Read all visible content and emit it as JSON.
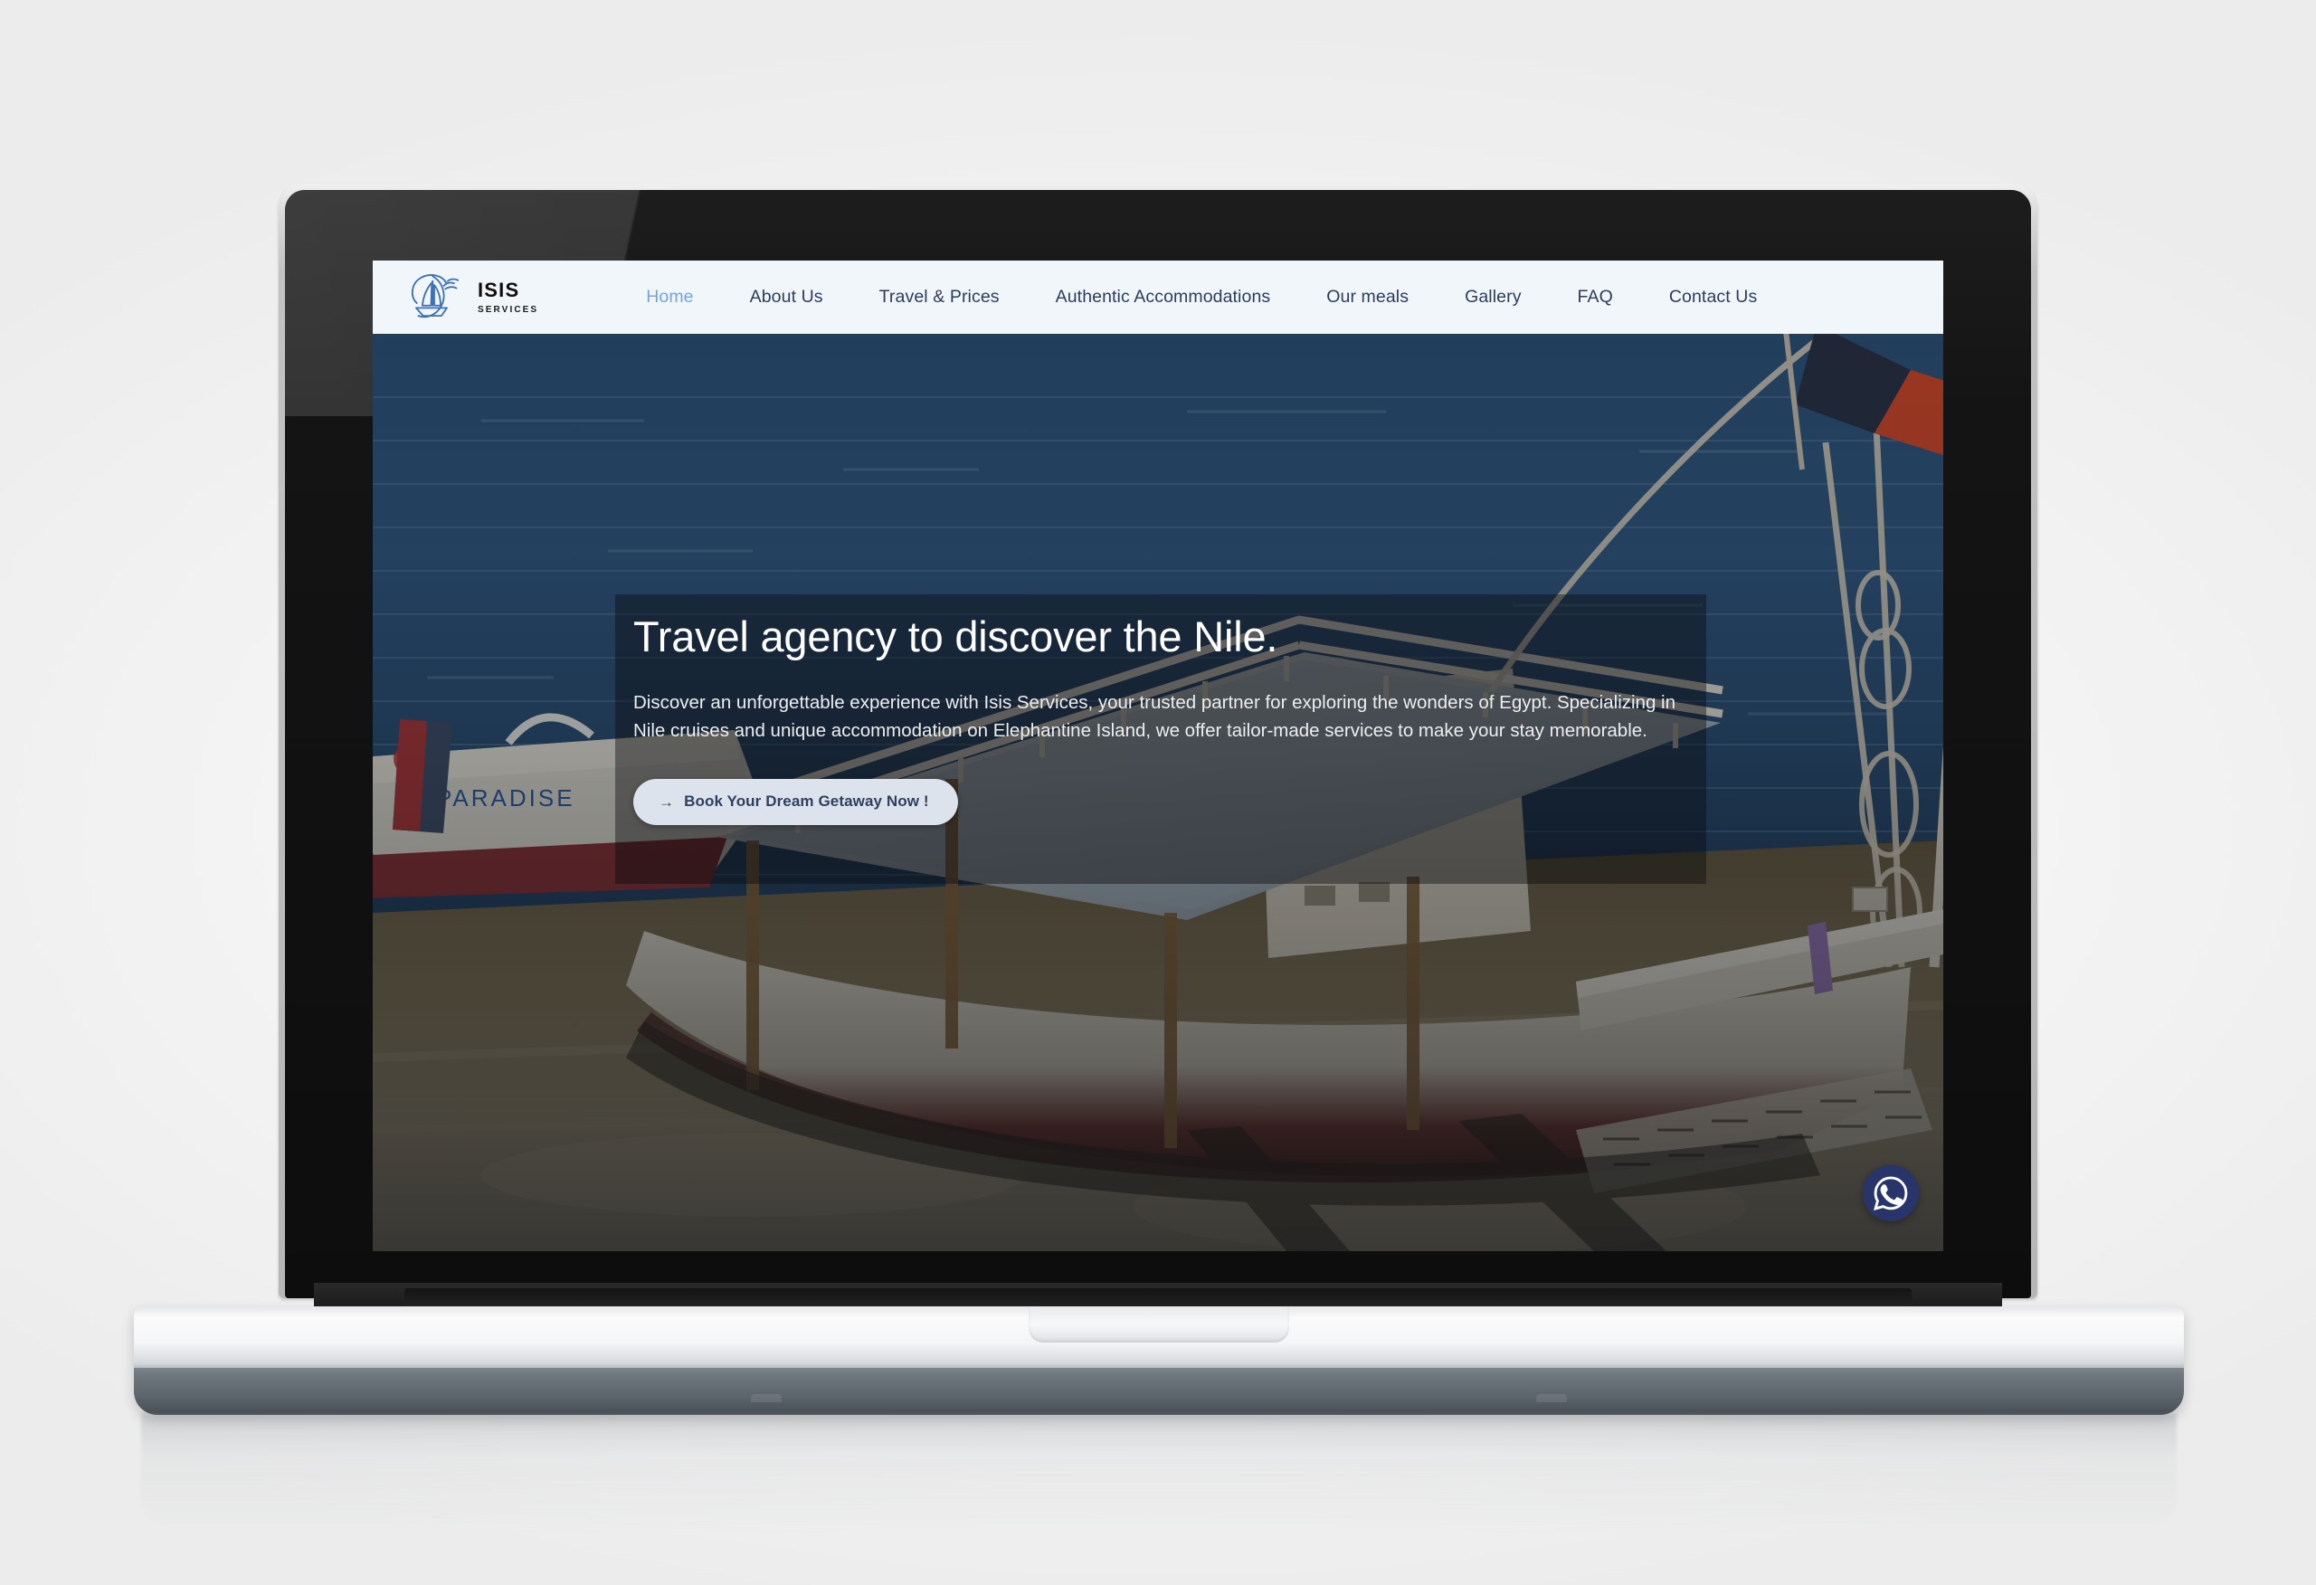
{
  "scene": {
    "device": "laptop-mockup",
    "camera_icon": "webcam-icon"
  },
  "site": {
    "brand": {
      "logo_icon": "sailboat-wave-logo-icon",
      "name": "ISIS",
      "tagline": "SERVICES"
    },
    "nav": {
      "items": [
        {
          "label": "Home",
          "active": true
        },
        {
          "label": "About Us",
          "active": false
        },
        {
          "label": "Travel & Prices",
          "active": false
        },
        {
          "label": "Authentic Accommodations",
          "active": false
        },
        {
          "label": "Our meals",
          "active": false
        },
        {
          "label": "Gallery",
          "active": false
        },
        {
          "label": "FAQ",
          "active": false
        },
        {
          "label": "Contact Us",
          "active": false
        }
      ]
    },
    "hero": {
      "title": "Travel agency to discover the Nile.",
      "description": "Discover an unforgettable experience with Isis Services, your trusted partner for exploring the wonders of Egypt. Specializing in Nile cruises and unique accommodation on Elephantine Island, we offer tailor-made services to make your stay memorable.",
      "cta": {
        "arrow_icon": "arrow-right-icon",
        "arrow_glyph": "→",
        "label": "Book Your Dream Getaway Now !"
      },
      "image_alt": "Felucca sailing boat moored on a sandy Nile riverbank with a man standing on deck"
    },
    "floating_action": {
      "icon": "whatsapp-icon",
      "label": "WhatsApp"
    },
    "colors": {
      "navbar_background": "#f1f6fb",
      "nav_link": "#2c3c5c",
      "nav_link_active": "#74a4e4",
      "logo_blue": "#3d6fb5",
      "cta_background": "#dde3ec",
      "cta_text": "#2f3f60",
      "whatsapp_badge": "#27356a",
      "hero_overlay": "rgba(10,10,12,0.42)",
      "page_backdrop": "#f4f4f4"
    }
  }
}
